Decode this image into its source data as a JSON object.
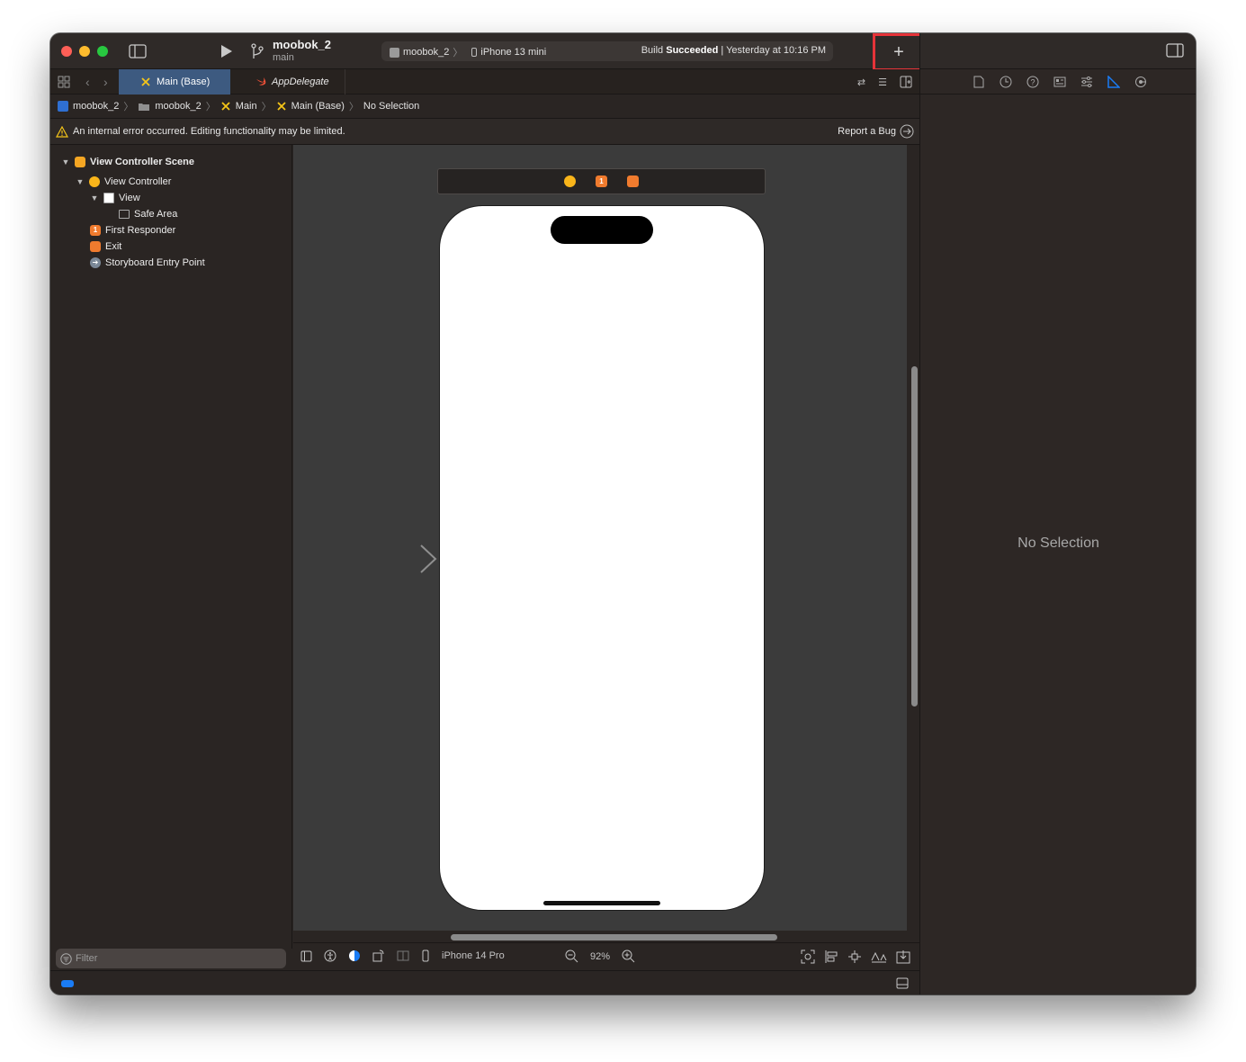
{
  "toolbar": {
    "project_name": "moobok_2",
    "branch_name": "main",
    "scheme_target": "moobok_2",
    "scheme_device": "iPhone 13 mini",
    "build_status_prefix": "Build",
    "build_status_result": "Succeeded",
    "build_status_time": "| Yesterday at 10:16 PM",
    "add_label": "+"
  },
  "tabs": [
    {
      "label": "Main (Base)",
      "active": true,
      "icon": "storyboard-icon"
    },
    {
      "label": "AppDelegate",
      "active": false,
      "icon": "swift-icon"
    }
  ],
  "jumpbar": [
    "moobok_2",
    "moobok_2",
    "Main",
    "Main (Base)",
    "No Selection"
  ],
  "warning": {
    "message": "An internal error occurred. Editing functionality may be limited.",
    "report_label": "Report a Bug"
  },
  "outline": {
    "scene": "View Controller Scene",
    "view_controller": "View Controller",
    "view": "View",
    "safe_area": "Safe Area",
    "first_responder": "First Responder",
    "exit": "Exit",
    "entry_point": "Storyboard Entry Point"
  },
  "filter": {
    "placeholder": "Filter"
  },
  "canvas_bar": {
    "device": "iPhone 14 Pro",
    "zoom": "92%"
  },
  "inspector": {
    "empty_message": "No Selection"
  },
  "colors": {
    "accent": "#3d5a80",
    "highlight": "#e63339",
    "status": "#1a7cf5"
  }
}
